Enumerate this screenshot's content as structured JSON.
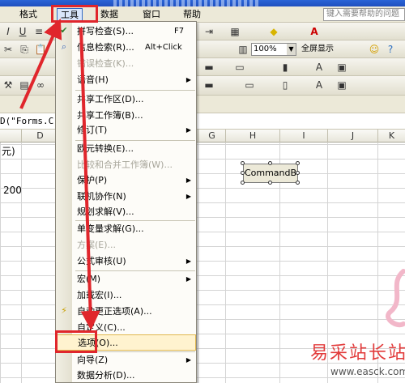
{
  "menubar": {
    "items": [
      {
        "label": "格式"
      },
      {
        "label": "工具"
      },
      {
        "label": "数据"
      },
      {
        "label": "窗口"
      },
      {
        "label": "帮助"
      }
    ],
    "help_placeholder": "键入需要帮助的问题"
  },
  "toolbar": {
    "zoom": "100%",
    "fullscreen_label": "全屏显示"
  },
  "formula": {
    "text": "D(\"Forms.C"
  },
  "grid": {
    "columns": [
      "D",
      "G",
      "H",
      "I",
      "J",
      "K"
    ],
    "cells": {
      "yuan": "元)",
      "value_200": "200"
    }
  },
  "control": {
    "label": "CommandB"
  },
  "dropdown": {
    "items": [
      {
        "label": "拼写检查(S)...",
        "shortcut": "F7",
        "icon": "spell-check-icon"
      },
      {
        "label": "信息检索(R)...",
        "shortcut": "Alt+Click",
        "icon": "research-icon"
      },
      {
        "label": "错误检查(K)...",
        "shortcut": "",
        "disabled": true
      },
      {
        "label": "语音(H)",
        "submenu": true
      },
      {
        "label": "共享工作区(D)..."
      },
      {
        "label": "共享工作簿(B)..."
      },
      {
        "label": "修订(T)",
        "submenu": true
      },
      {
        "label": "欧元转换(E)..."
      },
      {
        "label": "比较和合并工作簿(W)...",
        "disabled": true
      },
      {
        "label": "保护(P)",
        "submenu": true
      },
      {
        "label": "联机协作(N)",
        "submenu": true
      },
      {
        "label": "规划求解(V)..."
      },
      {
        "label": "单变量求解(G)..."
      },
      {
        "label": "方案(E)...",
        "disabled": true
      },
      {
        "label": "公式审核(U)",
        "submenu": true
      },
      {
        "label": "宏(M)",
        "submenu": true
      },
      {
        "label": "加载宏(I)..."
      },
      {
        "label": "自动更正选项(A)...",
        "icon": "autocorrect-icon"
      },
      {
        "label": "自定义(C)..."
      },
      {
        "label": "选项(O)...",
        "highlighted": true
      },
      {
        "label": "向导(Z)",
        "submenu": true
      },
      {
        "label": "数据分析(D)..."
      }
    ]
  },
  "watermark": {
    "text": "易采站长站",
    "url": "www.easck.com"
  },
  "colors": {
    "annotation_red": "#e0262c",
    "menu_highlight": "#fff3cf"
  }
}
